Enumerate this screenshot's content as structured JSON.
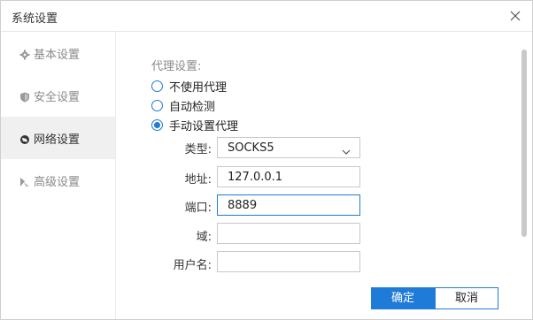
{
  "window": {
    "title": "系统设置"
  },
  "sidebar": {
    "items": [
      {
        "label": "基本设置",
        "icon": "gear-icon",
        "active": false
      },
      {
        "label": "安全设置",
        "icon": "shield-icon",
        "active": false
      },
      {
        "label": "网络设置",
        "icon": "globe-icon",
        "active": true
      },
      {
        "label": "高级设置",
        "icon": "advanced-icon",
        "active": false
      }
    ]
  },
  "proxy": {
    "section_label": "代理设置:",
    "options": [
      {
        "label": "不使用代理",
        "checked": false
      },
      {
        "label": "自动检测",
        "checked": false
      },
      {
        "label": "手动设置代理",
        "checked": true
      }
    ],
    "fields": {
      "type_label": "类型:",
      "type_value": "SOCKS5",
      "address_label": "地址:",
      "address_value": "127.0.0.1",
      "port_label": "端口:",
      "port_value": "8889",
      "domain_label": "域:",
      "domain_value": "",
      "username_label": "用户名:",
      "username_value": ""
    }
  },
  "buttons": {
    "ok_label": "确定",
    "cancel_label": "取消"
  },
  "colors": {
    "accent": "#1f7bd8",
    "active_bg": "#f0f0f0"
  }
}
